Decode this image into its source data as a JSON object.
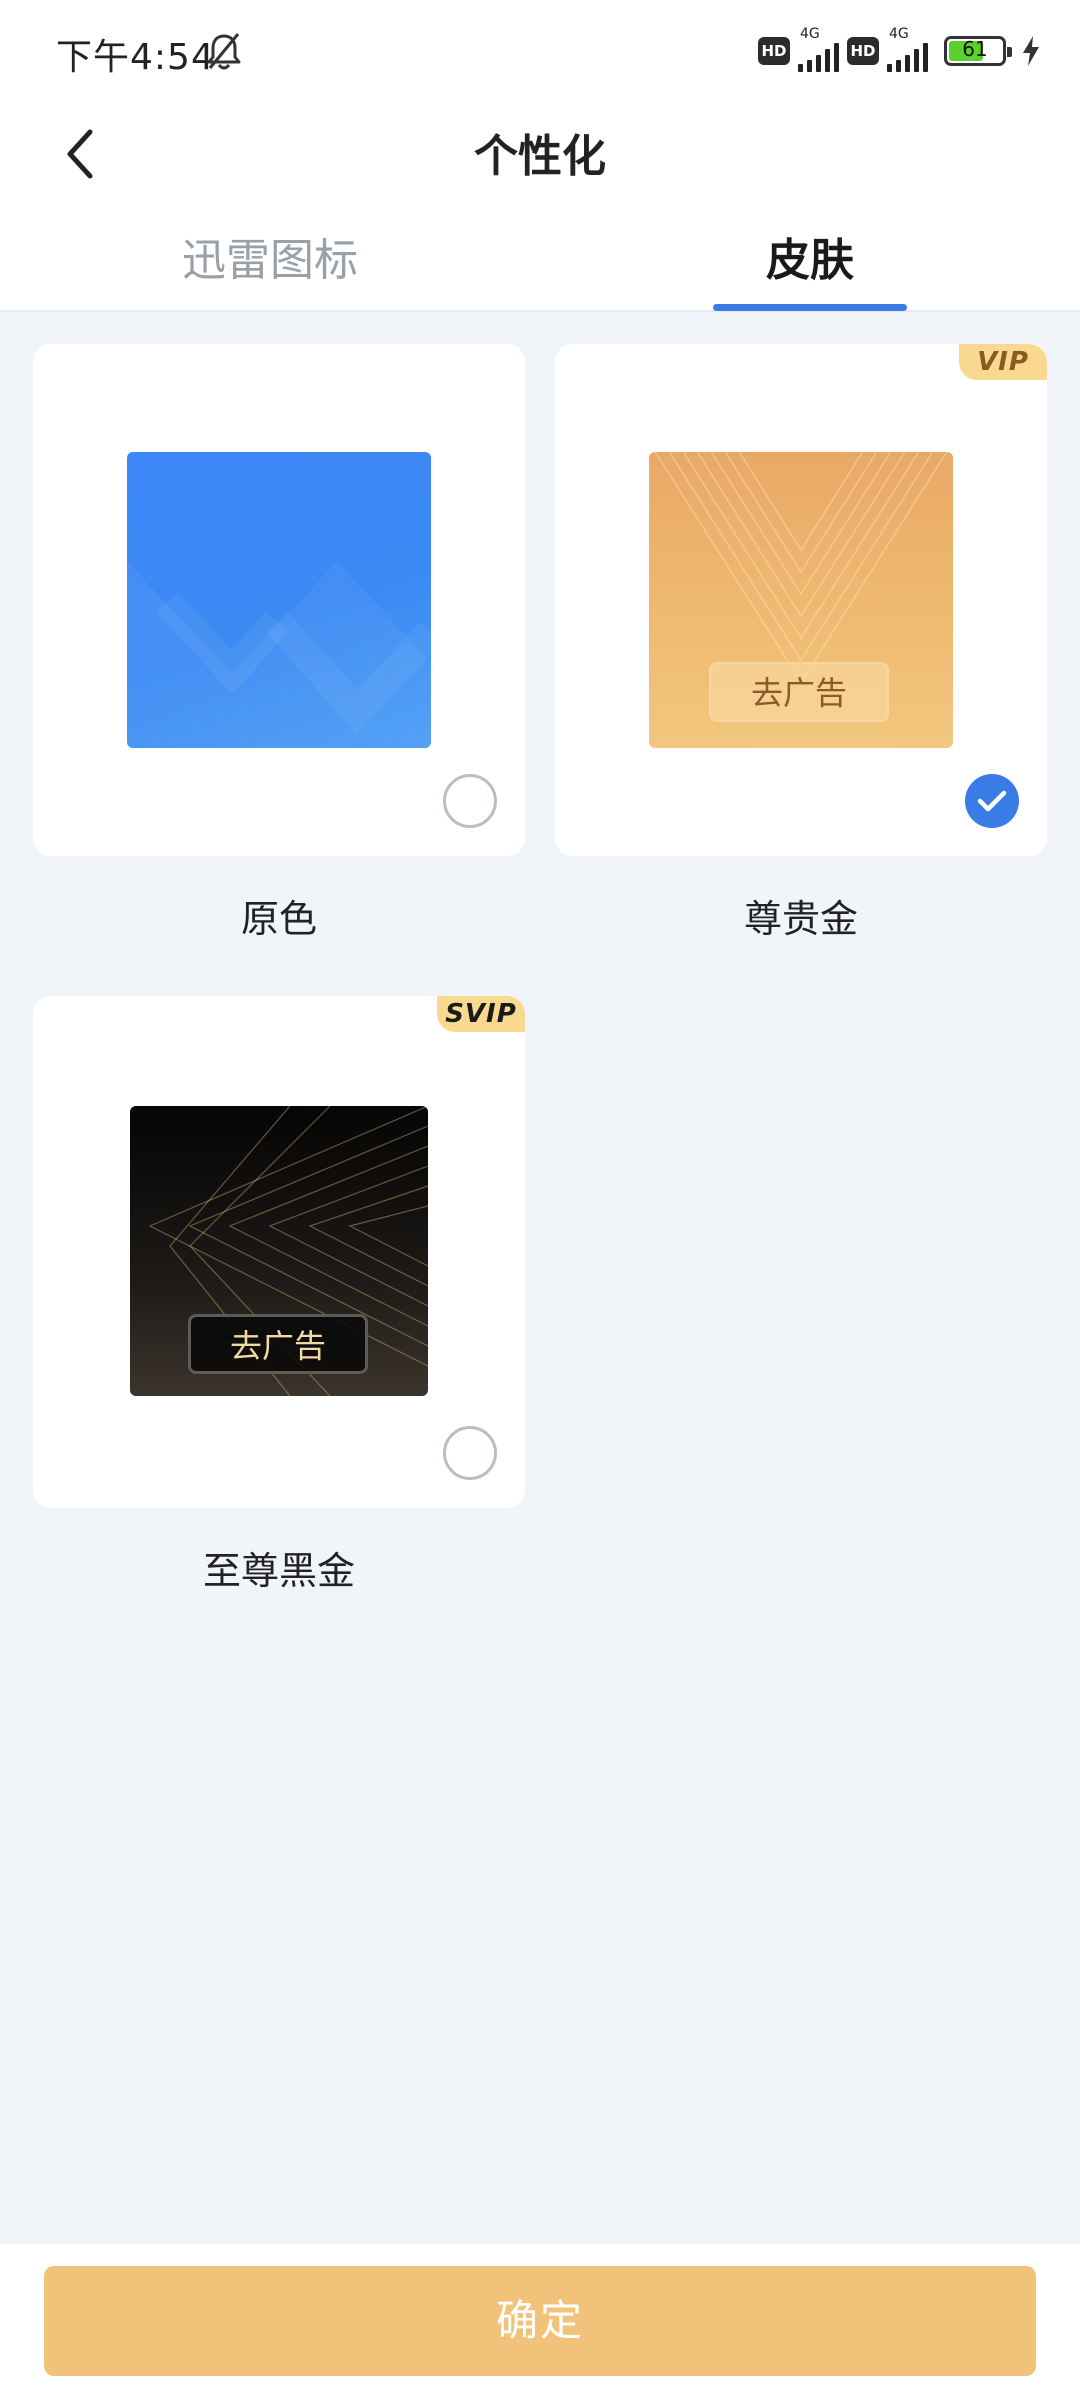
{
  "status_bar": {
    "time": "下午4:54",
    "hd1": "HD",
    "net1": "4G",
    "hd2": "HD",
    "net2": "4G",
    "battery": "61",
    "battery_color": "#5ad12c"
  },
  "header": {
    "title": "个性化",
    "back_icon": "chevron-left-icon"
  },
  "tabs": [
    {
      "label": "迅雷图标",
      "active": false
    },
    {
      "label": "皮肤",
      "active": true
    }
  ],
  "accent_color": "#3a7ce6",
  "skins": [
    {
      "name": "原色",
      "badge": "",
      "ad_label": "",
      "selected": false
    },
    {
      "name": "尊贵金",
      "badge": "VIP",
      "ad_label": "去广告",
      "selected": true
    },
    {
      "name": "至尊黑金",
      "badge": "SVIP",
      "ad_label": "去广告",
      "selected": false
    }
  ],
  "footer": {
    "confirm_label": "确定",
    "confirm_color": "#f1c37a"
  }
}
